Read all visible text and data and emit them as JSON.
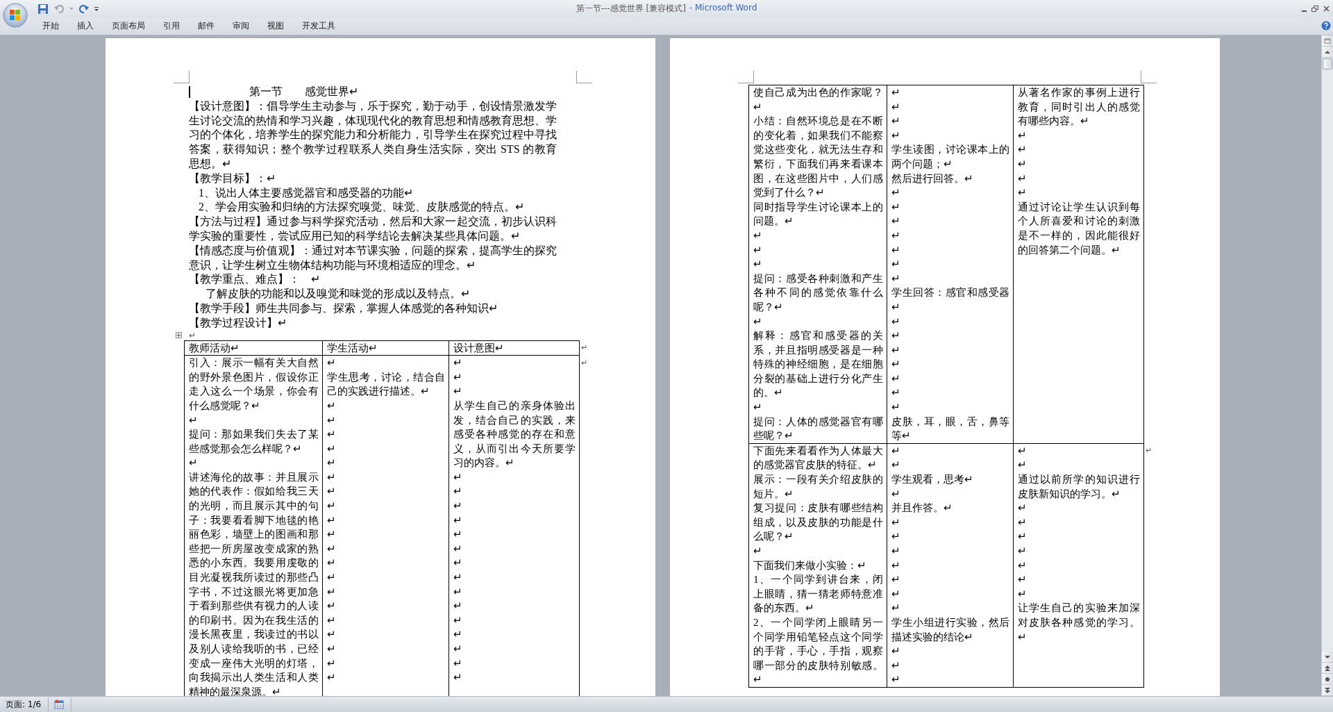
{
  "window": {
    "title": "第一节---感觉世界 [兼容模式]",
    "app_name": "- Microsoft Word"
  },
  "ribbon_tabs": [
    {
      "label": "开始",
      "selected": false
    },
    {
      "label": "插入",
      "selected": false
    },
    {
      "label": "页面布局",
      "selected": false
    },
    {
      "label": "引用",
      "selected": false
    },
    {
      "label": "邮件",
      "selected": false
    },
    {
      "label": "审阅",
      "selected": false
    },
    {
      "label": "视图",
      "selected": false
    },
    {
      "label": "开发工具",
      "selected": false
    }
  ],
  "pages": [
    {
      "paragraphs": [
        {
          "kind": "title",
          "text": "第一节　　感觉世界↵"
        },
        {
          "kind": "body",
          "text": "【设计意图】：倡导学生主动参与，乐于探究，勤于动手，创设情景激发学生讨论交流的热情和学习兴趣，体现现代化的教育思想和情感教育思想、学习的个体化，培养学生的探究能力和分析能力，引导学生在探究过程中寻找答案，获得知识；整个教学过程联系人类自身生活实际，突出 STS 的教育思想。↵"
        },
        {
          "kind": "body",
          "text": "【教学目标】：↵"
        },
        {
          "kind": "list",
          "text": "1、说出人体主要感觉器官和感受器的功能↵"
        },
        {
          "kind": "list",
          "text": "2、学会用实验和归纳的方法探究嗅觉、味觉、皮肤感觉的特点。↵"
        },
        {
          "kind": "body",
          "text": "【方法与过程】通过参与科学探究活动，然后和大家一起交流，初步认识科学实验的重要性，尝试应用已知的科学结论去解决某些具体问题。↵"
        },
        {
          "kind": "body",
          "text": "【情感态度与价值观】：通过对本节课实验，问题的探索，提高学生的探究意识，让学生树立生物体结构功能与环境相适应的理念。↵"
        },
        {
          "kind": "body",
          "text": "【教学重点、难点】：　↵"
        },
        {
          "kind": "indent",
          "text": "了解皮肤的功能和以及嗅觉和味觉的形成以及特点。↵"
        },
        {
          "kind": "body",
          "text": "【教学手段】师生共同参与、探索，掌握人体感觉的各种知识↵"
        },
        {
          "kind": "body",
          "text": "【教学过程设计】↵"
        },
        {
          "kind": "anchor",
          "text": "↵"
        }
      ],
      "table": {
        "rows": [
          {
            "end_mark": "↵",
            "cells": [
              [
                "教师活动↵"
              ],
              [
                "学生活动↵"
              ],
              [
                "设计意图↵"
              ]
            ]
          },
          {
            "end_mark": "↵",
            "cells": [
              [
                "引入：展示一幅有关大自然的野外景色图片，假设你正走入这么一个场景，你会有什么感觉呢？↵",
                "↵",
                "提问：那如果我们失去了某些感觉那会怎么样呢？↵",
                "↵",
                "讲述海伦的故事：并且展示她的代表作：假如给我三天的光明，而且展示其中的句子：我要看看脚下地毯的艳丽色彩，墙壁上的图画和那些把一所房屋改变成家的熟悉的小东西。我要用虔敬的目光凝视我所读过的那些凸字书，不过这眼光将更加急于看到那些供有视力的人读的印刷书。因为在我生活的漫长黑夜里，我读过的书以及别人读给我听的书，已经变成一座伟大光明的灯塔，向我揭示出人类生活和人类精神的最深泉源。↵"
              ],
              [
                "↵",
                "学生思考，讨论，结合自己的实践进行描述。↵",
                "↵",
                "↵",
                "↵",
                "↵",
                "↵",
                "↵",
                "↵",
                "↵",
                "↵",
                "↵",
                "↵",
                "↵",
                "↵",
                "↵",
                "↵",
                "↵",
                "↵",
                "↵",
                "↵",
                "↵"
              ],
              [
                "↵",
                "↵",
                "↵",
                "从学生自己的亲身体验出发，结合自己的实践，来感受各种感觉的存在和意义，从而引出今天所要学习的内容。↵",
                "↵",
                "↵",
                "↵",
                "↵",
                "↵",
                "↵",
                "↵",
                "↵",
                "↵",
                "↵",
                "↵",
                "↵",
                "↵",
                "↵",
                "↵"
              ]
            ]
          }
        ]
      }
    },
    {
      "table": {
        "rows": [
          {
            "cells": [
              [
                "使自己成为出色的作家呢？↵",
                "小结：自然环境总是在不断的变化着，如果我们不能察觉这些变化，就无法生存和繁衍，下面我们再来看课本图，在这些图片中，人们感觉到了什么？↵",
                "同时指导学生讨论课本上的问题。↵",
                "↵",
                "↵",
                "↵",
                "提问：感受各种刺激和产生各种不同的感觉依靠什么呢？↵",
                "↵",
                "解释：感官和感受器的关系，并且指明感受器是一种特殊的神经细胞，是在细胞分裂的基础上进行分化产生的。↵",
                "↵",
                "提问：人体的感觉器官有哪些呢？↵"
              ],
              [
                "↵",
                "↵",
                "↵",
                "↵",
                "学生读图，讨论课本上的两个问题；↵",
                "然后进行回答。↵",
                "↵",
                "↵",
                "↵",
                "↵",
                "↵",
                "↵",
                "↵",
                "学生回答：感官和感受器↵",
                "↵",
                "↵",
                "↵",
                "↵",
                "↵",
                "↵",
                "↵",
                "皮肤，耳，眼，舌，鼻等等↵"
              ],
              [
                "从著名作家的事例上进行教育，同时引出人的感觉有哪些内容。↵",
                "↵",
                "↵",
                "↵",
                "↵",
                "↵",
                "通过讨论让学生认识到每个人所喜爱和讨论的刺激是不一样的，因此能很好的回答第二个问题。↵"
              ]
            ]
          },
          {
            "end_mark": "↵",
            "cells": [
              [
                "下面先来看看作为人体最大的感觉器官皮肤的特征。↵",
                "展示：一段有关介绍皮肤的短片。↵",
                "复习提问：皮肤有哪些结构组成，以及皮肤的功能是什么呢？↵",
                "↵",
                "下面我们来做小实验：↵",
                "1、一个同学到讲台来，闭上眼睛，猜一猜老师特意准备的东西。↵",
                "2、一个同学闭上眼睛另一个同学用铅笔轻点这个同学的手背，手心，手指，观察哪一部分的皮肤特别敏感。↵"
              ],
              [
                "↵",
                "↵",
                "学生观看，思考↵",
                "↵",
                "并且作答。↵",
                "↵",
                "↵",
                "↵",
                "↵",
                "↵",
                "↵",
                "↵",
                "学生小组进行实验，然后描述实验的结论↵",
                "↵",
                "↵",
                "↵"
              ],
              [
                "↵",
                "↵",
                "通过以前所学的知识进行皮肤新知识的学习。↵",
                "↵",
                "↵",
                "↵",
                "↵",
                "↵",
                "↵",
                "↵",
                "让学生自己的实验来加深对皮肤各种感觉的学习。↵"
              ]
            ]
          }
        ]
      }
    }
  ],
  "status_bar": {
    "page": "页面: 1/6"
  }
}
